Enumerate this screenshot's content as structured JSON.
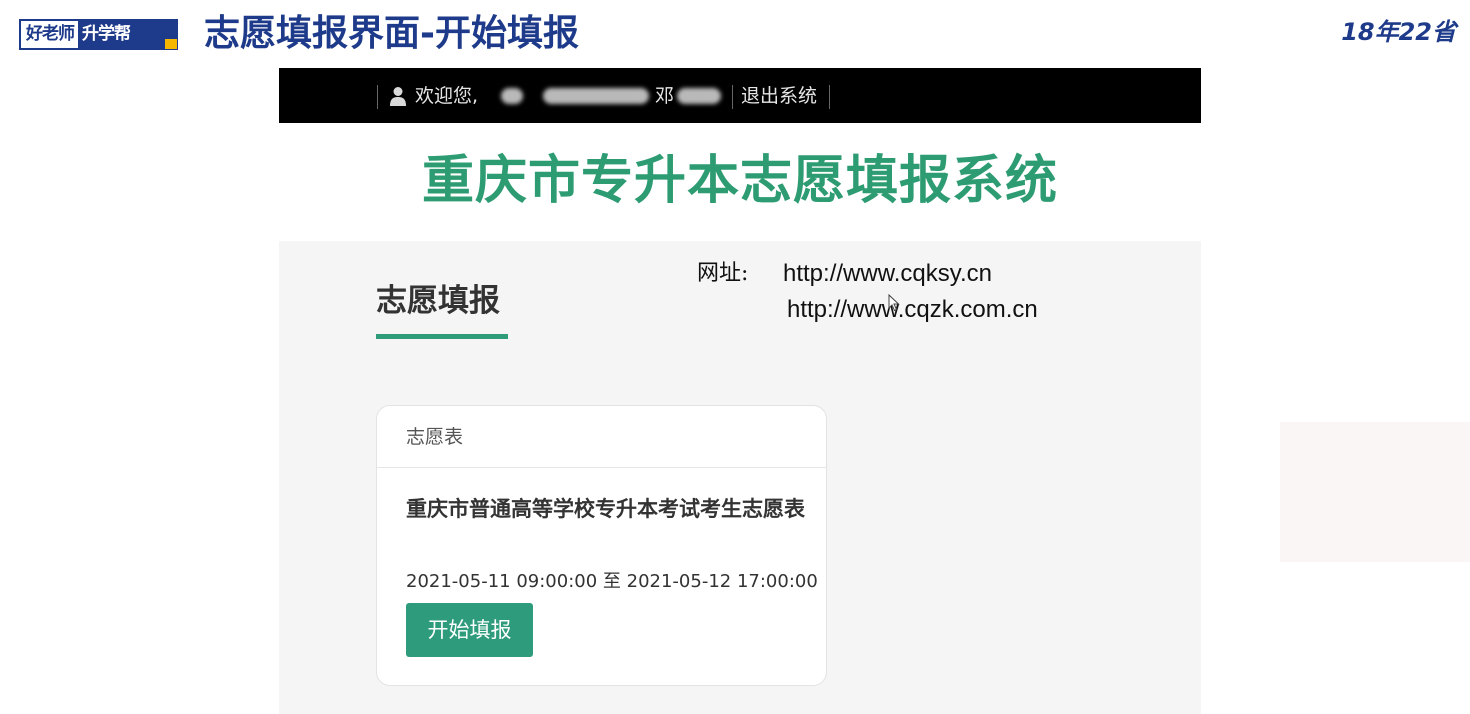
{
  "slide": {
    "logo_left": "好老师",
    "logo_right": "升学帮",
    "title": "志愿填报界面-开始填报",
    "corner_tag": "18年22省"
  },
  "topbar": {
    "welcome": "欢迎您,",
    "username_visible": "邓",
    "logout": "退出系统"
  },
  "system_title": "重庆市专升本志愿填报系统",
  "section": {
    "title": "志愿填报"
  },
  "website": {
    "label": "网址:",
    "urls": [
      "http://www.cqksy.cn",
      "http://www.cqzk.com.cn"
    ]
  },
  "card": {
    "header": "志愿表",
    "form_title": "重庆市普通高等学校专升本考试考生志愿表",
    "period": "2021-05-11 09:00:00 至 2021-05-12 17:00:00",
    "button": "开始填报"
  },
  "colors": {
    "brand_blue": "#1e3a8a",
    "accent_green": "#2e9c78",
    "topbar_bg": "#000000"
  }
}
